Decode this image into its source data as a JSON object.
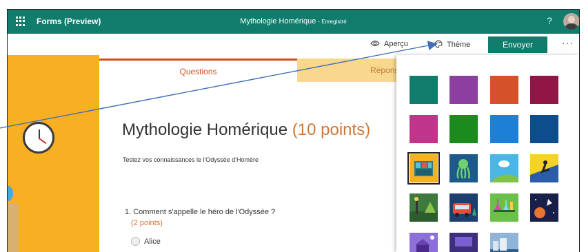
{
  "app": {
    "name": "Forms (Preview)",
    "doc_title": "Mythologie Homérique",
    "doc_status": "- Enregistré",
    "help": "?"
  },
  "toolbar": {
    "preview": "Aperçu",
    "theme": "Thème",
    "send": "Envoyer",
    "more": "···"
  },
  "tabs": {
    "questions": "Questions",
    "responses": "Réponses"
  },
  "form": {
    "title": "Mythologie Homérique",
    "points": "(10 points)",
    "description": "Testez vos connaissances le l'Odyssée d'Homère",
    "question_1": "1. Comment s'appelle le héro de l'Odyssée ?",
    "question_1_points": "(2 points)",
    "option_1": "Alice"
  },
  "theme_colors": {
    "teal": "#0f7c6c",
    "purple": "#8c3fa0",
    "orange": "#d5512a",
    "maroon": "#901646",
    "pink": "#c0348c",
    "green": "#1b8b1e",
    "blue": "#1d7fd6",
    "navy": "#0c4e8c"
  },
  "theme_images": [
    "bookshelf",
    "octopus",
    "sunny-hill",
    "snowboarder",
    "park",
    "bus",
    "lab-flasks",
    "space-rocket",
    "purple-house",
    "arcade",
    "city-sea"
  ]
}
